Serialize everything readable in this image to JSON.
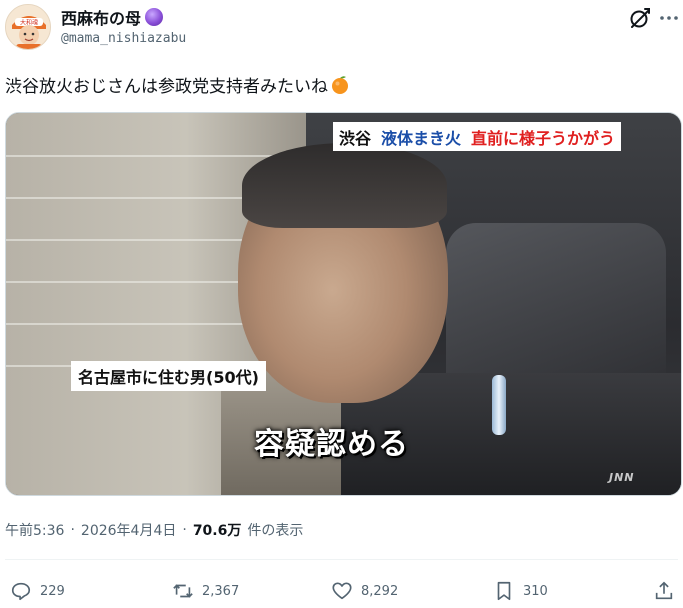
{
  "user": {
    "display_name": "西麻布の母",
    "name_emoji": "crystal-ball-emoji",
    "handle": "@mama_nishiazabu",
    "avatar_badge": "大和魂"
  },
  "post": {
    "text": "渋谷放火おじさんは参政党支持者みたいね",
    "text_emoji": "orange-emoji"
  },
  "media": {
    "caption_top": [
      "渋谷",
      "液体まき火",
      "直前に様子うかがう"
    ],
    "caption_left": "名古屋市に住む男(50代)",
    "caption_main": "容疑認める",
    "watermark": "JNN",
    "caption_colors": {
      "location": "#111111",
      "topic": "#1b4ea8",
      "headline": "#e02020"
    }
  },
  "meta": {
    "time": "午前5:36",
    "date": "2026年4月4日",
    "views_count": "70.6万",
    "views_label": "件の表示"
  },
  "actions": {
    "replies": "229",
    "reposts": "2,367",
    "likes": "8,292",
    "bookmarks": "310"
  },
  "icons": [
    "grok-icon",
    "more-icon",
    "reply-icon",
    "repost-icon",
    "like-icon",
    "bookmark-icon",
    "share-icon"
  ],
  "colors": {
    "secondary_text": "#536471",
    "primary_text": "#0f1419"
  }
}
